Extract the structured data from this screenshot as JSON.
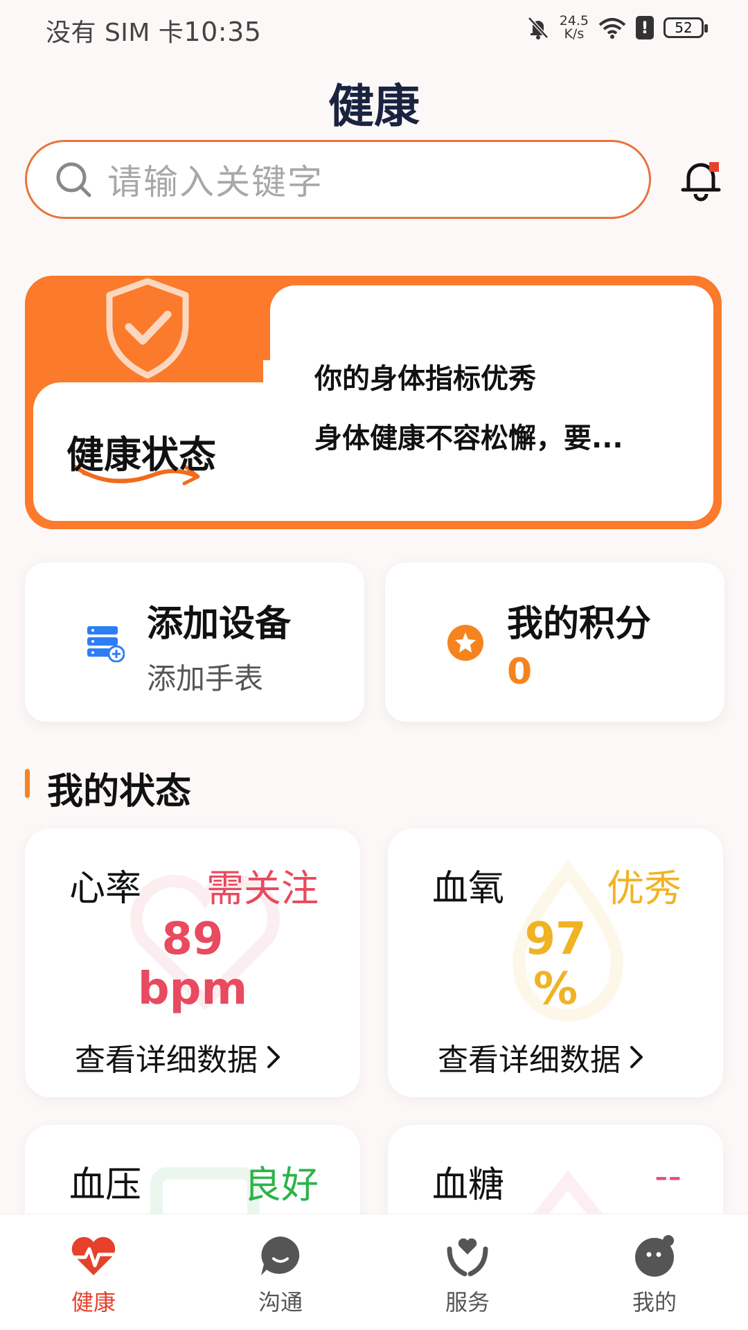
{
  "status_bar": {
    "carrier": "没有 SIM 卡",
    "time": "10:35",
    "net_speed_value": "24.5",
    "net_speed_unit": "K/s",
    "battery": "52"
  },
  "header": {
    "title": "健康"
  },
  "search": {
    "placeholder": "请输入关键字"
  },
  "health_status": {
    "title": "健康状态",
    "line1": "你的身体指标优秀",
    "line2": "身体健康不容松懈，要..."
  },
  "quick_cards": {
    "device": {
      "title": "添加设备",
      "subtitle": "添加手表"
    },
    "points": {
      "title": "我的积分",
      "value": "0"
    }
  },
  "section": {
    "title": "我的状态"
  },
  "metrics": [
    {
      "name": "心率",
      "badge": "需关注",
      "badge_color": "#e84a5f",
      "value": "89",
      "unit": "bpm",
      "value_color": "#e84a5f",
      "link": "查看详细数据"
    },
    {
      "name": "血氧",
      "badge": "优秀",
      "badge_color": "#f0b323",
      "value": "97",
      "unit": "%",
      "value_color": "#f0b323",
      "link": "查看详细数据"
    },
    {
      "name": "血压",
      "badge": "良好",
      "badge_color": "#2db34a"
    },
    {
      "name": "血糖",
      "badge": "--",
      "badge_color": "#e84a7f"
    }
  ],
  "bottom_nav": [
    {
      "label": "健康",
      "icon": "heart-pulse-icon",
      "active": true
    },
    {
      "label": "沟通",
      "icon": "chat-bubble-icon",
      "active": false
    },
    {
      "label": "服务",
      "icon": "hands-heart-icon",
      "active": false
    },
    {
      "label": "我的",
      "icon": "profile-face-icon",
      "active": false
    }
  ],
  "colors": {
    "accent": "#fb7a2b",
    "active_nav": "#e5412b",
    "title_navy": "#1a2340"
  }
}
